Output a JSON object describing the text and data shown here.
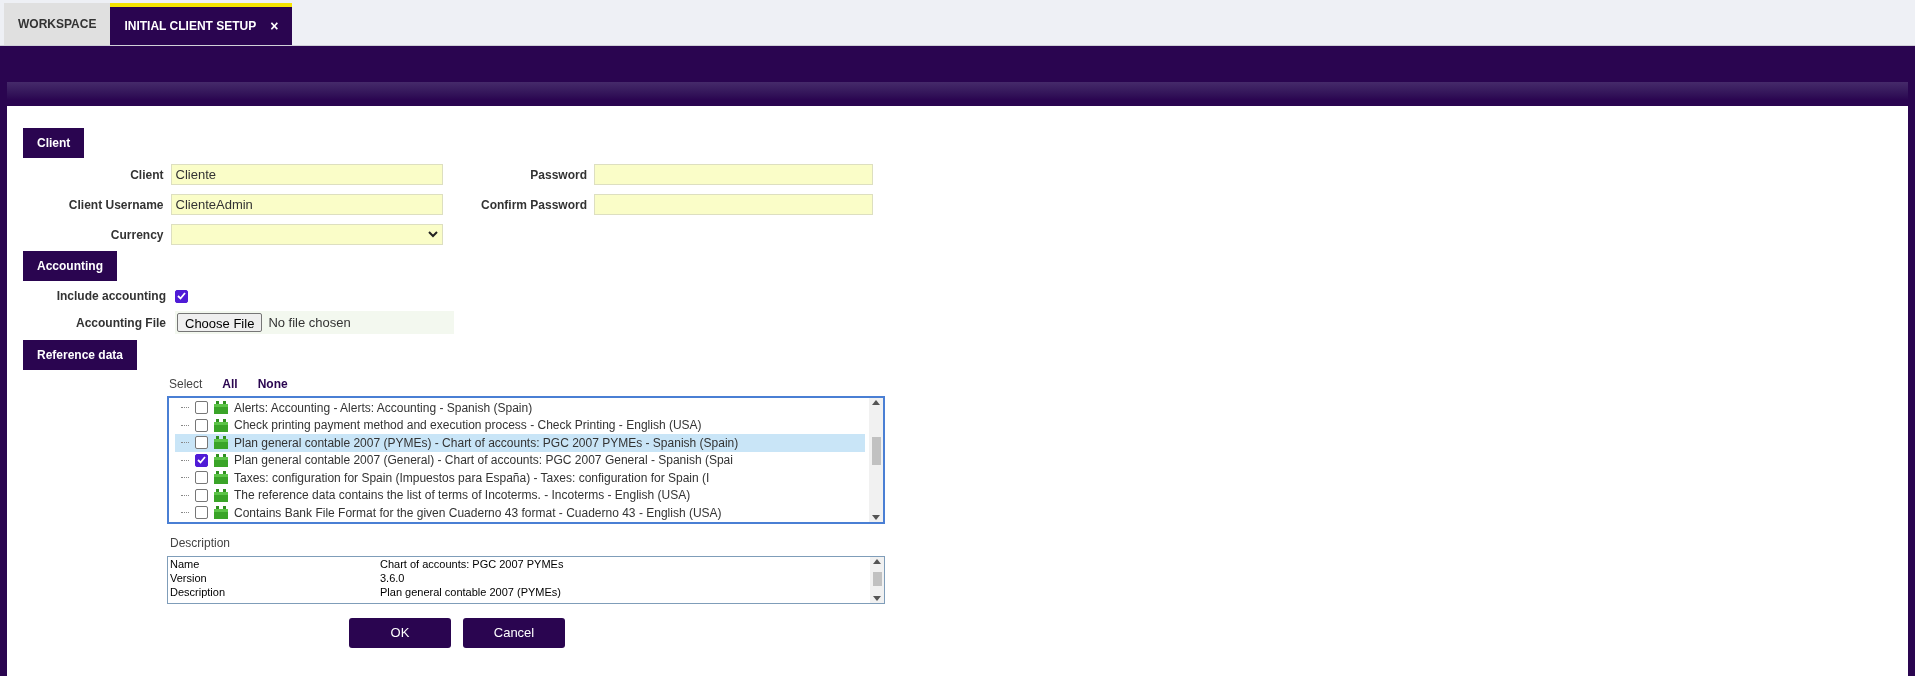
{
  "tabs": [
    {
      "label": "WORKSPACE",
      "selected": false
    },
    {
      "label": "INITIAL CLIENT SETUP",
      "selected": true,
      "close": "×"
    }
  ],
  "client_section": {
    "heading": "Client",
    "left_fields": [
      {
        "label": "Client",
        "kind": "text",
        "value": "Cliente"
      },
      {
        "label": "Client Username",
        "kind": "text",
        "value": "ClienteAdmin"
      },
      {
        "label": "Currency",
        "kind": "select"
      }
    ],
    "right_fields": [
      {
        "label": "Password",
        "kind": "password"
      },
      {
        "label": "Confirm Password",
        "kind": "password"
      }
    ]
  },
  "accounting_section": {
    "heading": "Accounting",
    "include_accounting": {
      "label": "Include accounting",
      "checked": true
    },
    "accounting_file": {
      "label": "Accounting File",
      "button": "Choose File",
      "status": "No file chosen"
    }
  },
  "reference_data_section": {
    "heading": "Reference data",
    "select_label": "Select",
    "links": [
      "All",
      "None"
    ],
    "items": [
      {
        "label": "Alerts: Accounting - Alerts: Accounting - Spanish (Spain)",
        "checked": false,
        "selected": false
      },
      {
        "label": "Check printing payment method and execution process - Check Printing - English (USA)",
        "checked": false,
        "selected": false
      },
      {
        "label": "Plan general contable 2007 (PYMEs) - Chart of accounts: PGC 2007 PYMEs - Spanish (Spain)",
        "checked": false,
        "selected": true
      },
      {
        "label": "Plan general contable 2007 (General) - Chart of accounts: PGC 2007 General - Spanish (Spai",
        "checked": true,
        "selected": false
      },
      {
        "label": "Taxes: configuration for Spain (Impuestos para España) - Taxes: configuration for Spain (I",
        "checked": false,
        "selected": false
      },
      {
        "label": "The reference data contains the list of terms of Incoterms. - Incoterms - English (USA)",
        "checked": false,
        "selected": false
      },
      {
        "label": "Contains Bank File Format for the given Cuaderno 43 format - Cuaderno 43 - English (USA)",
        "checked": false,
        "selected": false
      }
    ],
    "description": {
      "label": "Description",
      "rows": [
        {
          "name": "Name",
          "value": "Chart of accounts: PGC 2007 PYMEs"
        },
        {
          "name": "Version",
          "value": "3.6.0"
        },
        {
          "name": "Description",
          "value": "Plan general contable 2007 (PYMEs)"
        }
      ]
    }
  },
  "buttons": [
    "OK",
    "Cancel"
  ]
}
